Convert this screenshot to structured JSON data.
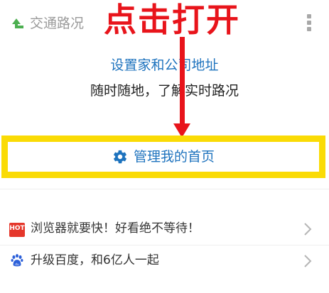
{
  "header": {
    "title": "交通路况",
    "icon": "traffic-arrow-icon",
    "menu_icon": "more-vertical-icon"
  },
  "annotation": {
    "text": "点击打开",
    "color": "#e8141b"
  },
  "card": {
    "set_address_link": "设置家和公司地址",
    "tagline": "随时随地，了解实时路况"
  },
  "manage": {
    "label": "管理我的首页",
    "icon": "gear-icon",
    "highlight_color": "#fadb05"
  },
  "list": [
    {
      "badge": "HOT",
      "label": "浏览器就要快！好看绝不等待！",
      "icon": "hot-badge-icon"
    },
    {
      "label": "升级百度，和6亿人一起",
      "icon": "baidu-paw-icon"
    }
  ],
  "colors": {
    "link": "#1e73be",
    "text": "#222222",
    "muted": "#9a9a9a",
    "green": "#4caf50"
  }
}
